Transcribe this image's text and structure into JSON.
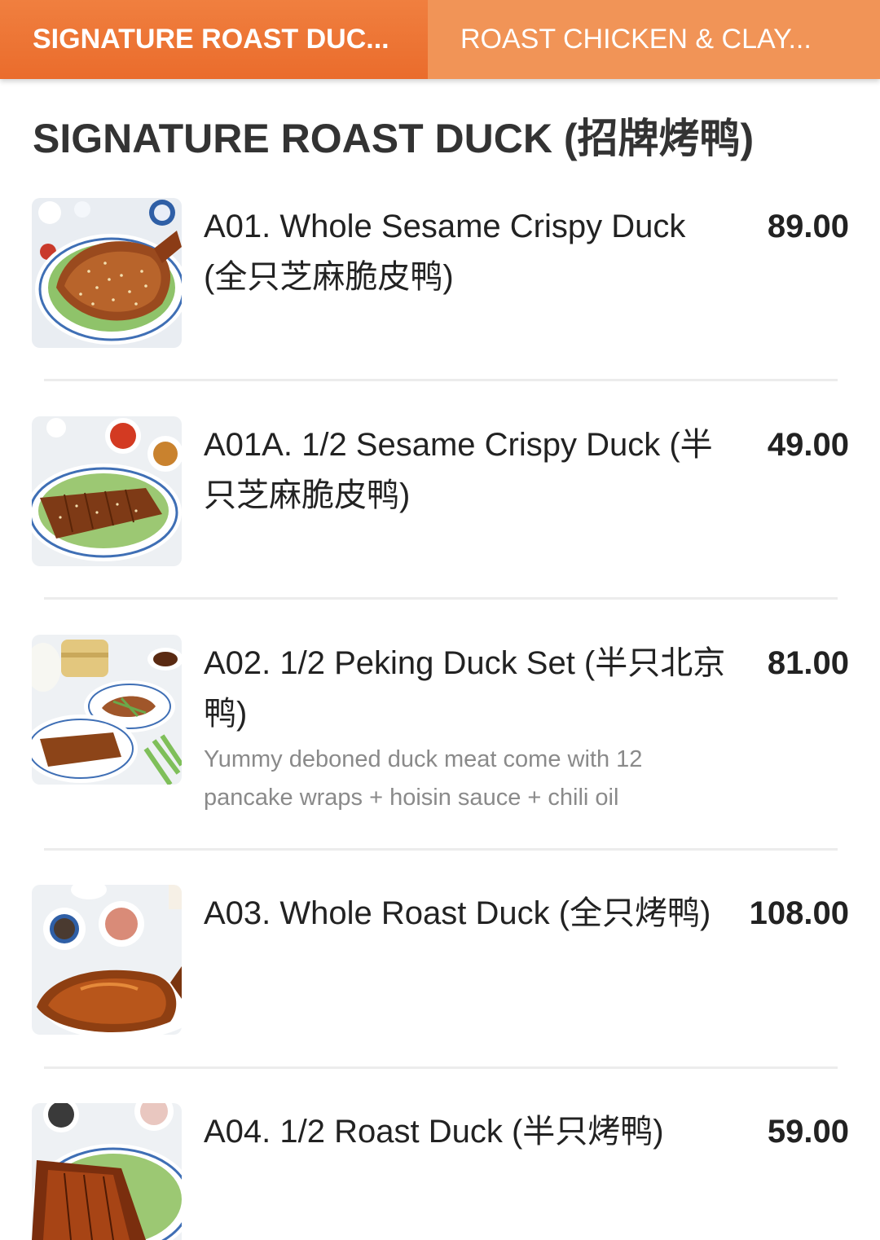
{
  "tabs": [
    {
      "label": "SIGNATURE ROAST DUC...",
      "active": true
    },
    {
      "label": "ROAST CHICKEN & CLAY...",
      "active": false
    }
  ],
  "section": {
    "title": "SIGNATURE ROAST DUCK (招牌烤鸭)"
  },
  "colors": {
    "accent": "#ea6c2c",
    "tab_inactive": "#f19457"
  },
  "items": [
    {
      "name": "A01. Whole Sesame Crispy Duck (全只芝麻脆皮鸭)",
      "price": "89.00",
      "image": "whole-sesame-crispy-duck-photo"
    },
    {
      "name": "A01A. 1/2 Sesame Crispy Duck (半只芝麻脆皮鸭)",
      "price": "49.00",
      "image": "half-sesame-crispy-duck-photo"
    },
    {
      "name": "A02. 1/2 Peking Duck Set (半只北京鸭)",
      "price": "81.00",
      "description": "Yummy deboned duck meat come with 12 pancake wraps + hoisin sauce + chili oil",
      "image": "peking-duck-set-photo"
    },
    {
      "name": "A03. Whole Roast Duck (全只烤鸭)",
      "price": "108.00",
      "image": "whole-roast-duck-photo"
    },
    {
      "name": "A04. 1/2 Roast Duck (半只烤鸭)",
      "price": "59.00",
      "image": "half-roast-duck-photo"
    }
  ]
}
